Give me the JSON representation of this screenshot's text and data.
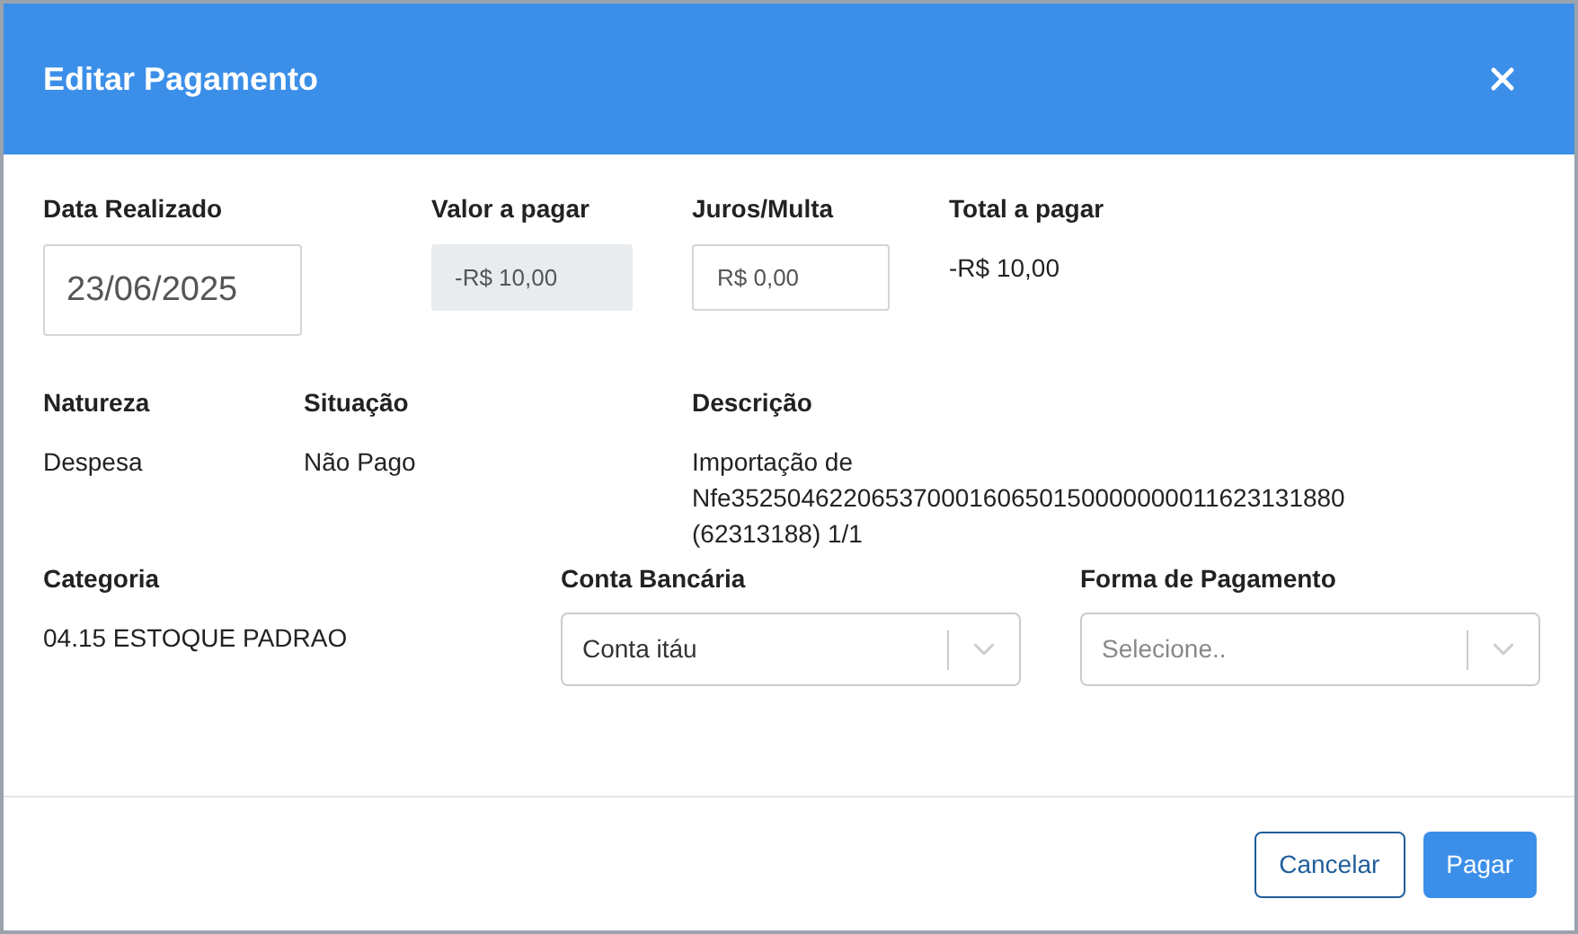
{
  "dialog": {
    "title": "Editar Pagamento"
  },
  "row_1": [
    {
      "label": "Data Realizado",
      "value": "23/06/2025",
      "kind": "date"
    },
    {
      "label": "Valor a pagar",
      "value": "-R$ 10,00",
      "kind": "readonly"
    },
    {
      "label": "Juros/Multa",
      "value": "R$ 0,00",
      "kind": "input"
    },
    {
      "label": "Total a pagar",
      "value": "-R$ 10,00",
      "kind": "text"
    }
  ],
  "row_2": [
    {
      "label": "Natureza",
      "value": "Despesa",
      "kind": "text"
    },
    {
      "label": "Situação",
      "value": "Não Pago",
      "kind": "text"
    },
    {
      "label": "Descrição",
      "value": "Importação de Nfe35250462206537000160650150000000011623131880 (62313188) 1/1",
      "kind": "text"
    }
  ],
  "row_3": [
    {
      "label": "Categoria",
      "value": "04.15 ESTOQUE PADRAO",
      "kind": "text"
    },
    {
      "label": "Conta Bancária",
      "value": "Conta itáu",
      "kind": "select"
    },
    {
      "label": "Forma de Pagamento",
      "placeholder": "Selecione..",
      "kind": "select"
    }
  ],
  "buttons": [
    {
      "label": "Cancelar",
      "kind": "secondary"
    },
    {
      "label": "Pagar",
      "kind": "primary"
    }
  ]
}
